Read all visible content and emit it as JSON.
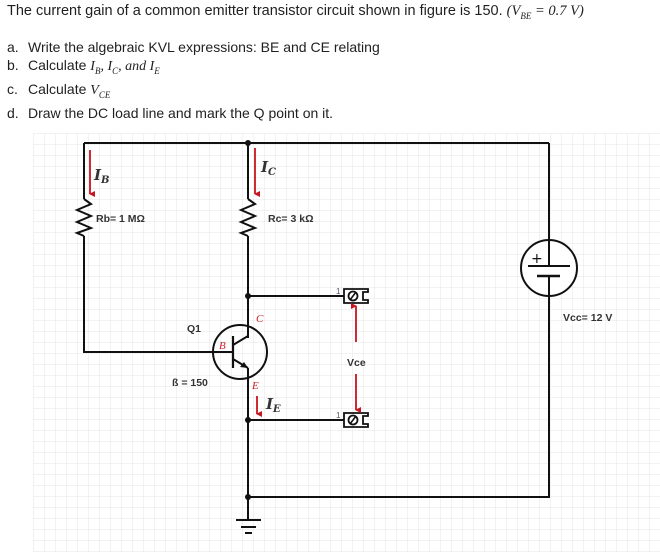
{
  "question": {
    "intro": "The current gain of a common emitter transistor circuit shown in figure is 150.",
    "given": "(V",
    "given_sub": "BE",
    "given_rest": " = 0.7 V)"
  },
  "tasks": [
    {
      "letter": "a.",
      "text": "Write the algebraic KVL expressions: BE and CE relating"
    },
    {
      "letter": "b.",
      "text": "Calculate ",
      "math": "I",
      "sub1": "B",
      "m2": ", I",
      "sub2": "C",
      "m3": ",  and I",
      "sub3": "E"
    },
    {
      "letter": "c.",
      "text": "Calculate ",
      "math": "V",
      "sub1": "CE"
    },
    {
      "letter": "d.",
      "text": "Draw the DC load line and mark the Q point on it."
    }
  ],
  "circuit": {
    "rb_label": "Rb= 1 MΩ",
    "rc_label": "Rc= 3 kΩ",
    "q_label": "Q1",
    "beta_label": "ß = 150",
    "vcc_label": "Vcc= 12 V",
    "vce_label": "Vce",
    "ib_label": "I",
    "ib_sub": "B",
    "ic_label": "I",
    "ic_sub": "C",
    "ie_label": "I",
    "ie_sub": "E",
    "pin_b": "B",
    "pin_c": "C",
    "pin_e": "E",
    "terminal_top_num": "1",
    "terminal_bottom_num": "1",
    "plus_sign": "+",
    "colors": {
      "wire": "#111111",
      "arrow": "#c8141e",
      "grid": "#e6e6e6",
      "pin_text": "#d0202a"
    }
  }
}
